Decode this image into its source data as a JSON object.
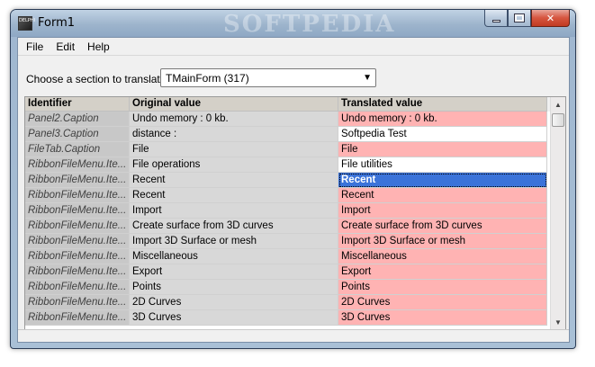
{
  "window": {
    "title": "Form1",
    "watermark": "SOFTPEDIA",
    "icon_text": "DELPHI"
  },
  "menu": [
    "File",
    "Edit",
    "Help"
  ],
  "section": {
    "label": "Choose a section to translate:",
    "selected": "TMainForm (317)"
  },
  "grid": {
    "columns": [
      "Identifier",
      "Original value",
      "Translated value"
    ],
    "rows": [
      {
        "id": "Panel2.Caption",
        "original": "Undo memory : 0 kb.",
        "translated": "Undo memory : 0 kb.",
        "state": "untr"
      },
      {
        "id": "Panel3.Caption",
        "original": "distance :",
        "translated": "Softpedia Test",
        "state": "tr"
      },
      {
        "id": "FileTab.Caption",
        "original": "File",
        "translated": "File",
        "state": "untr"
      },
      {
        "id": "RibbonFileMenu.Ite...",
        "original": "File operations",
        "translated": "File utilities",
        "state": "tr"
      },
      {
        "id": "RibbonFileMenu.Ite...",
        "original": "Recent",
        "translated": "Recent",
        "state": "sel"
      },
      {
        "id": "RibbonFileMenu.Ite...",
        "original": "Recent",
        "translated": "Recent",
        "state": "untr"
      },
      {
        "id": "RibbonFileMenu.Ite...",
        "original": "Import",
        "translated": "Import",
        "state": "untr"
      },
      {
        "id": "RibbonFileMenu.Ite...",
        "original": "Create surface from 3D curves",
        "translated": "Create surface from 3D curves",
        "state": "untr"
      },
      {
        "id": "RibbonFileMenu.Ite...",
        "original": "Import 3D Surface or mesh",
        "translated": "Import 3D Surface or mesh",
        "state": "untr"
      },
      {
        "id": "RibbonFileMenu.Ite...",
        "original": "Miscellaneous",
        "translated": "Miscellaneous",
        "state": "untr"
      },
      {
        "id": "RibbonFileMenu.Ite...",
        "original": "Export",
        "translated": "Export",
        "state": "untr"
      },
      {
        "id": "RibbonFileMenu.Ite...",
        "original": "Points",
        "translated": "Points",
        "state": "untr"
      },
      {
        "id": "RibbonFileMenu.Ite...",
        "original": "2D Curves",
        "translated": "2D Curves",
        "state": "untr"
      },
      {
        "id": "RibbonFileMenu.Ite...",
        "original": "3D Curves",
        "translated": "3D Curves",
        "state": "untr"
      }
    ]
  },
  "icons": {
    "combo_arrow": "chevron-down-icon",
    "scroll_up": "arrow-up-icon",
    "scroll_down": "arrow-down-icon"
  },
  "colors": {
    "untranslated": "#ffb3b3",
    "selected": "#3b73d9",
    "translated": "#ffffff"
  }
}
